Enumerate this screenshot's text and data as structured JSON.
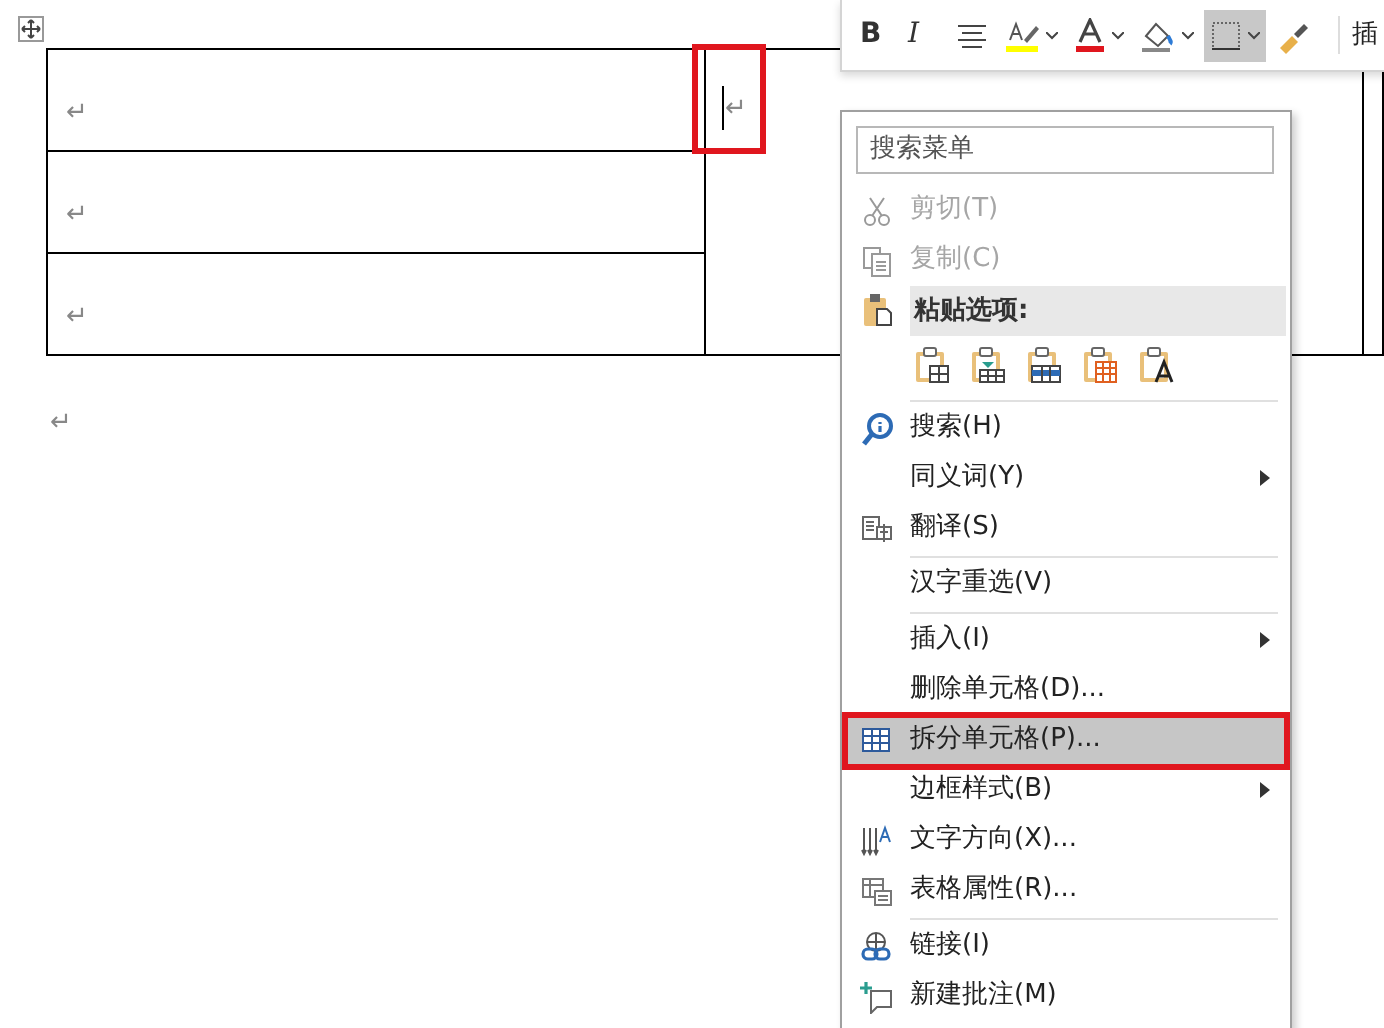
{
  "document": {
    "table_rows": [
      {
        "mark": "↵"
      },
      {
        "mark": "↵"
      },
      {
        "mark": "↵"
      }
    ],
    "merged_cell": {
      "mark": "↵",
      "annotated": true
    },
    "after_table_mark": "↵"
  },
  "mini_toolbar": {
    "bold": "B",
    "italic": "I",
    "border_selected": true,
    "cut_label": "插"
  },
  "context_menu": {
    "search": {
      "placeholder": "搜索菜单"
    },
    "items": [
      {
        "kind": "item",
        "label": "剪切(T)",
        "disabled": true,
        "submenu": false,
        "selected": false,
        "annotated": false
      },
      {
        "kind": "item",
        "label": "复制(C)",
        "disabled": true,
        "submenu": false,
        "selected": false,
        "annotated": false
      },
      {
        "kind": "header",
        "label": "粘贴选项:"
      },
      {
        "kind": "paste"
      },
      {
        "kind": "separator"
      },
      {
        "kind": "item",
        "label": "搜索(H)",
        "disabled": false,
        "submenu": false,
        "selected": false,
        "annotated": false
      },
      {
        "kind": "item",
        "label": "同义词(Y)",
        "disabled": false,
        "submenu": true,
        "selected": false,
        "annotated": false
      },
      {
        "kind": "item",
        "label": "翻译(S)",
        "disabled": false,
        "submenu": false,
        "selected": false,
        "annotated": false
      },
      {
        "kind": "separator"
      },
      {
        "kind": "item",
        "label": "汉字重选(V)",
        "disabled": false,
        "submenu": false,
        "selected": false,
        "annotated": false
      },
      {
        "kind": "separator"
      },
      {
        "kind": "item",
        "label": "插入(I)",
        "disabled": false,
        "submenu": true,
        "selected": false,
        "annotated": false
      },
      {
        "kind": "item",
        "label": "删除单元格(D)...",
        "disabled": false,
        "submenu": false,
        "selected": false,
        "annotated": false
      },
      {
        "kind": "item",
        "label": "拆分单元格(P)...",
        "disabled": false,
        "submenu": false,
        "selected": true,
        "annotated": true
      },
      {
        "kind": "item",
        "label": "边框样式(B)",
        "disabled": false,
        "submenu": true,
        "selected": false,
        "annotated": false
      },
      {
        "kind": "item",
        "label": "文字方向(X)...",
        "disabled": false,
        "submenu": false,
        "selected": false,
        "annotated": false
      },
      {
        "kind": "item",
        "label": "表格属性(R)...",
        "disabled": false,
        "submenu": false,
        "selected": false,
        "annotated": false
      },
      {
        "kind": "separator"
      },
      {
        "kind": "item",
        "label": "链接(I)",
        "disabled": false,
        "submenu": false,
        "selected": false,
        "annotated": false
      },
      {
        "kind": "item",
        "label": "新建批注(M)",
        "disabled": false,
        "submenu": false,
        "selected": false,
        "annotated": false
      }
    ]
  }
}
